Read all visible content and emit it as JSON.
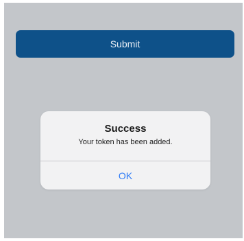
{
  "form": {
    "submit_label": "Submit"
  },
  "alert": {
    "title": "Success",
    "message": "Your token has been added.",
    "ok_label": "OK"
  },
  "colors": {
    "background": "#c3c6ca",
    "button": "#0e5189",
    "alert_background": "#f2f2f3",
    "link": "#2f7cf6"
  }
}
